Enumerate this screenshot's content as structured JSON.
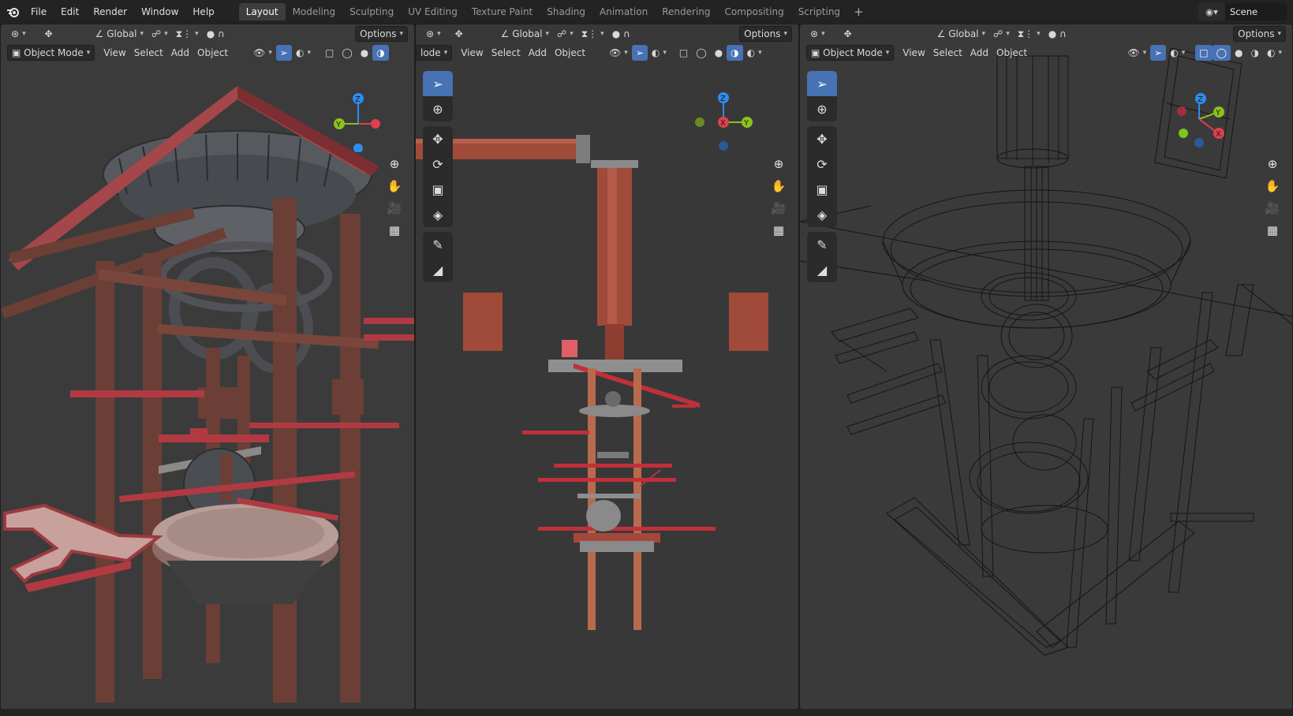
{
  "menu": [
    "File",
    "Edit",
    "Render",
    "Window",
    "Help"
  ],
  "workspaces": [
    "Layout",
    "Modeling",
    "Sculpting",
    "UV Editing",
    "Texture Paint",
    "Shading",
    "Animation",
    "Rendering",
    "Compositing",
    "Scripting"
  ],
  "active_workspace": "Layout",
  "scene_name": "Scene",
  "viewports": [
    {
      "transform_orientation": "Global",
      "options_label": "Options",
      "mode": "Object Mode",
      "view": "View",
      "select": "Select",
      "add": "Add",
      "object": "Object",
      "shading": "solid"
    },
    {
      "transform_orientation": "Global",
      "options_label": "Options",
      "mode": "lode",
      "view": "View",
      "select": "Select",
      "add": "Add",
      "object": "Object",
      "shading": "material"
    },
    {
      "transform_orientation": "Global",
      "options_label": "Options",
      "mode": "Object Mode",
      "view": "View",
      "select": "Select",
      "add": "Add",
      "object": "Object",
      "shading": "wireframe"
    }
  ],
  "gizmo_labels": {
    "z": "Z",
    "y": "Y",
    "x": "X"
  },
  "colors": {
    "accent_blue": "#4772b3",
    "axis_x": "#e0404e",
    "axis_y": "#8bc21c",
    "axis_z": "#2d8cf0",
    "wood": "#6e3f34",
    "red": "#c0303a"
  }
}
